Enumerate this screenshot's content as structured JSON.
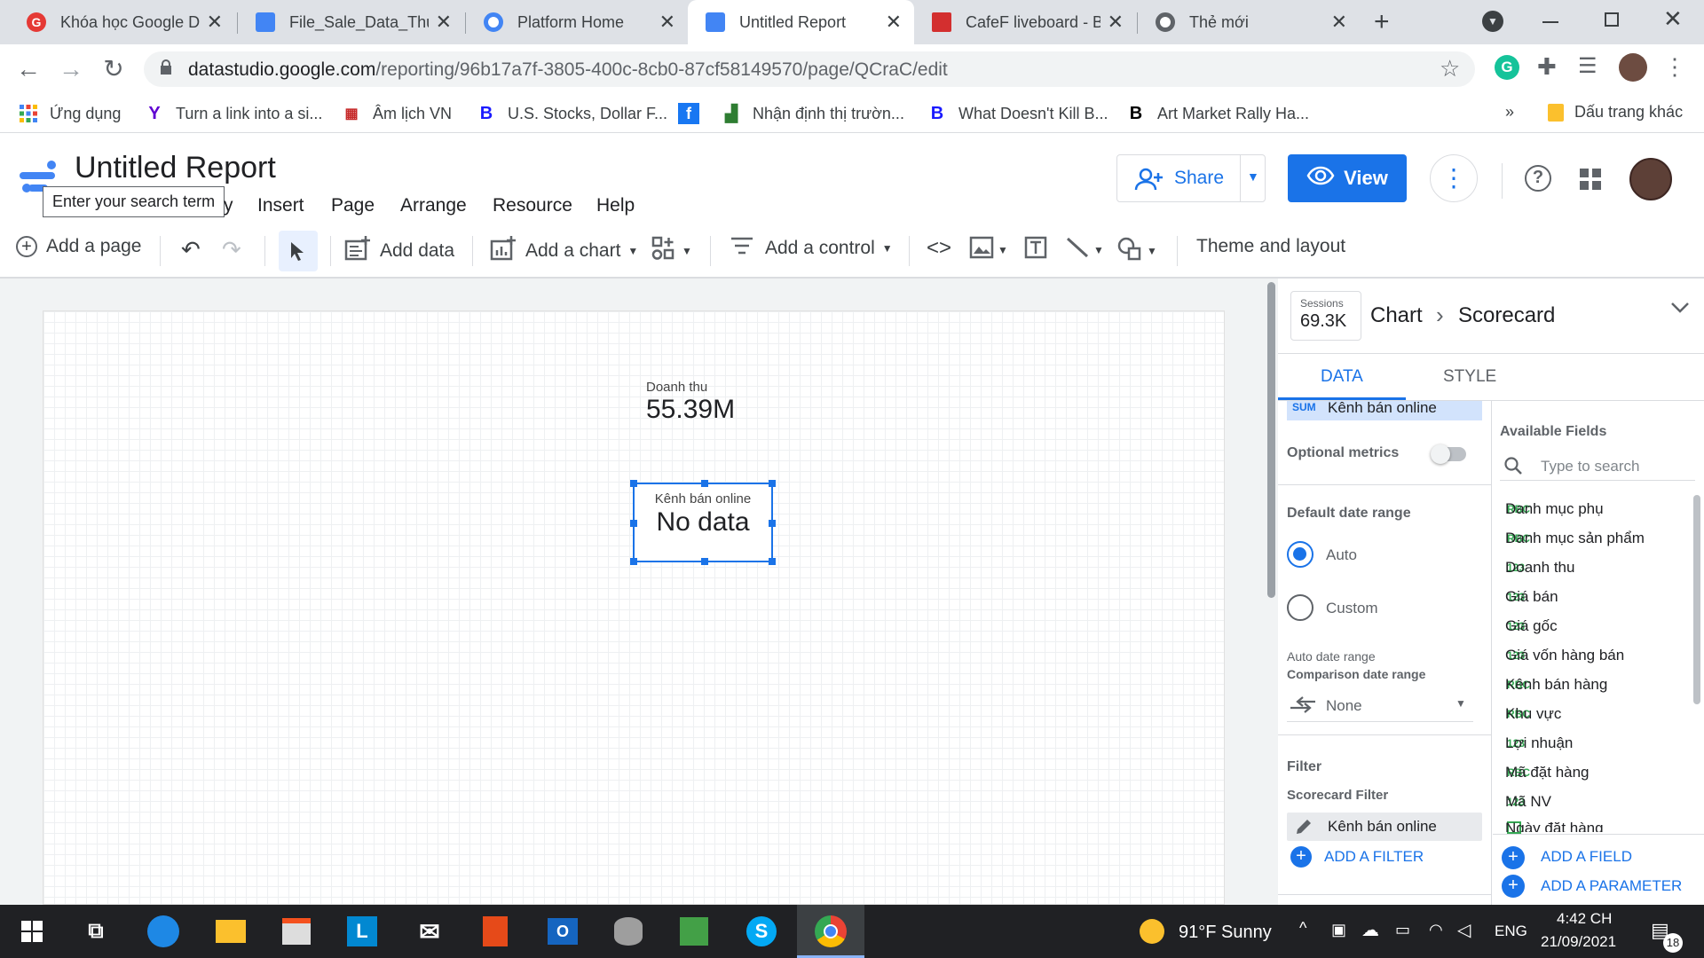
{
  "browser": {
    "tabs": [
      {
        "title": "Khóa học Google D",
        "icon": "g-icon",
        "color": "#e53935"
      },
      {
        "title": "File_Sale_Data_Thuc",
        "icon": "datastudio-icon",
        "color": "#4285f4"
      },
      {
        "title": "Platform Home",
        "icon": "platform-icon",
        "color": "#4285f4"
      },
      {
        "title": "Untitled Report",
        "icon": "datastudio-icon",
        "color": "#4285f4"
      },
      {
        "title": "CafeF liveboard - B",
        "icon": "cafef-icon",
        "color": "#d32f2f"
      },
      {
        "title": "Thẻ mới",
        "icon": "chrome-icon",
        "color": "#5f6368"
      }
    ],
    "url_host": "datastudio.google.com",
    "url_path": "/reporting/96b17a7f-3805-400c-8cb0-87cf58149570/page/QCraC/edit",
    "bookmarks": [
      {
        "label": "Ứng dụng",
        "icon": "apps-grid-icon"
      },
      {
        "label": "Turn a link into a si...",
        "icon": "yahoo-icon"
      },
      {
        "label": "Âm lịch VN",
        "icon": "calendar-icon"
      },
      {
        "label": "U.S. Stocks, Dollar F...",
        "icon": "barrons-icon"
      },
      {
        "label": "",
        "icon": "facebook-icon"
      },
      {
        "label": "Nhận định thị trườn...",
        "icon": "chart-icon"
      },
      {
        "label": "What Doesn't Kill B...",
        "icon": "barrons-icon"
      },
      {
        "label": "Art Market Rally Ha...",
        "icon": "bloomberg-icon"
      }
    ],
    "more_bookmarks": "»",
    "other_bookmarks": "Dấu trang khác"
  },
  "app": {
    "title": "Untitled Report",
    "tooltip": "Enter your search term",
    "menu": [
      "Insert",
      "Page",
      "Arrange",
      "Resource",
      "Help"
    ],
    "share_label": "Share",
    "view_label": "View"
  },
  "toolbar": {
    "add_page": "Add a page",
    "add_data": "Add data",
    "add_chart": "Add a chart",
    "add_control": "Add a control",
    "theme_layout": "Theme and layout"
  },
  "canvas": {
    "scorecard1": {
      "label": "Doanh thu",
      "value": "55.39M"
    },
    "scorecard2": {
      "label": "Kênh bán online",
      "value": "No data"
    }
  },
  "panel": {
    "preview_label": "Sessions",
    "preview_value": "69.3K",
    "breadcrumb_root": "Chart",
    "breadcrumb_leaf": "Scorecard",
    "tab_data": "DATA",
    "tab_style": "STYLE",
    "metric_agg": "SUM",
    "metric_name": "Kênh bán online",
    "optional_metrics": "Optional metrics",
    "default_date_range": "Default date range",
    "auto": "Auto",
    "custom": "Custom",
    "auto_date_range": "Auto date range",
    "comparison_date_range": "Comparison date range",
    "comparison_value": "None",
    "filter": "Filter",
    "scorecard_filter": "Scorecard Filter",
    "filter_value": "Kênh bán online",
    "add_filter": "ADD A FILTER",
    "available_fields": "Available Fields",
    "search_placeholder": "Type to search",
    "fields": [
      {
        "type": "RBC",
        "name": "Danh mục phụ"
      },
      {
        "type": "RBC",
        "name": "Danh mục sản phẩm"
      },
      {
        "type": "123",
        "name": "Doanh thu"
      },
      {
        "type": "123",
        "name": "Giá bán"
      },
      {
        "type": "123",
        "name": "Giá gốc"
      },
      {
        "type": "123",
        "name": "Giá vốn hàng bán"
      },
      {
        "type": "RBC",
        "name": "Kênh bán hàng"
      },
      {
        "type": "RBC",
        "name": "Khu vực"
      },
      {
        "type": "123",
        "name": "Lợi nhuận"
      },
      {
        "type": "RBC",
        "name": "Mã đặt hàng"
      },
      {
        "type": "123",
        "name": "Mã NV"
      },
      {
        "type": "date",
        "name": "Ngày đặt hàng"
      }
    ],
    "add_field": "ADD A FIELD",
    "add_parameter": "ADD A PARAMETER"
  },
  "taskbar": {
    "weather": "91°F  Sunny",
    "lang": "ENG",
    "time": "4:42 CH",
    "date": "21/09/2021",
    "notifications": "18"
  }
}
